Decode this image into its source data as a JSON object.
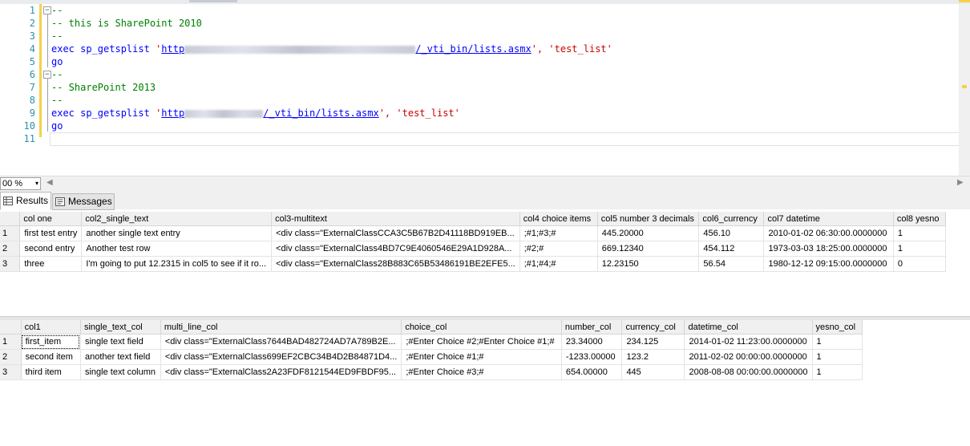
{
  "editor": {
    "line_numbers": [
      "1",
      "2",
      "3",
      "4",
      "5",
      "6",
      "7",
      "8",
      "9",
      "10",
      "11"
    ],
    "lines": {
      "l1": "--",
      "l2": "-- this is SharePoint 2010",
      "l3": "--",
      "l4_exec": "exec sp_getsplist",
      "l4_q1": "'",
      "l4_url_a": "http",
      "l4_url_b": "/_vti_bin/lists.asmx",
      "l4_q2": "',",
      "l4_arg": "'test_list'",
      "l5": "go",
      "l6": "--",
      "l7": "-- SharePoint 2013",
      "l8": "--",
      "l9_exec": "exec sp_getsplist",
      "l9_q1": "'",
      "l9_url_a": "http",
      "l9_url_b": "/_vti_bin/lists.asmx",
      "l9_q2": "',",
      "l9_arg": "'test_list'",
      "l10": "go"
    },
    "fold_glyph": "−"
  },
  "zoom": {
    "value": "00 %",
    "arrow": "▾"
  },
  "scroll": {
    "left_arrow": "◀",
    "right_arrow": "▶"
  },
  "tabs": {
    "results": "Results",
    "messages": "Messages"
  },
  "grid1": {
    "columns": [
      "col one",
      "col2_single_text",
      "col3-multitext",
      "col4 choice items",
      "col5 number 3 decimals",
      "col6_currency",
      "col7 datetime",
      "col8 yesno"
    ],
    "rows": [
      [
        "1",
        "first test entry",
        "another single text entry",
        "<div class=\"ExternalClassCCA3C5B67B2D41118BD919EB...",
        ";#1;#3;#",
        "445.20000",
        "456.10",
        "2010-01-02 06:30:00.0000000",
        "1"
      ],
      [
        "2",
        "second entry",
        "Another test row",
        "<div class=\"ExternalClass4BD7C9E4060546E29A1D928A...",
        ";#2;#",
        "669.12340",
        "454.112",
        "1973-03-03 18:25:00.0000000",
        "1"
      ],
      [
        "3",
        "three",
        "I'm going to put 12.2315 in col5 to see if it ro...",
        "<div class=\"ExternalClass28B883C65B53486191BE2EFE5...",
        ";#1;#4;#",
        "12.23150",
        "56.54",
        "1980-12-12 09:15:00.0000000",
        "0"
      ]
    ]
  },
  "grid2": {
    "columns": [
      "col1",
      "single_text_col",
      "multi_line_col",
      "choice_col",
      "number_col",
      "currency_col",
      "datetime_col",
      "yesno_col"
    ],
    "rows": [
      [
        "1",
        "first_item",
        "single text field",
        "<div class=\"ExternalClass7644BAD482724AD7A789B2E...",
        ";#Enter Choice #2;#Enter Choice #1;#",
        "23.34000",
        "234.125",
        "2014-01-02 11:23:00.0000000",
        "1"
      ],
      [
        "2",
        "second item",
        "another text field",
        "<div class=\"ExternalClass699EF2CBC34B4D2B84871D4...",
        ";#Enter Choice #1;#",
        "-1233.00000",
        "123.2",
        "2011-02-02 00:00:00.0000000",
        "1"
      ],
      [
        "3",
        "third item",
        "single text column",
        "<div class=\"ExternalClass2A23FDF8121544ED9FBDF95...",
        ";#Enter Choice #3;#",
        "654.00000",
        "445",
        "2008-08-08 00:00:00.0000000",
        "1"
      ]
    ]
  }
}
